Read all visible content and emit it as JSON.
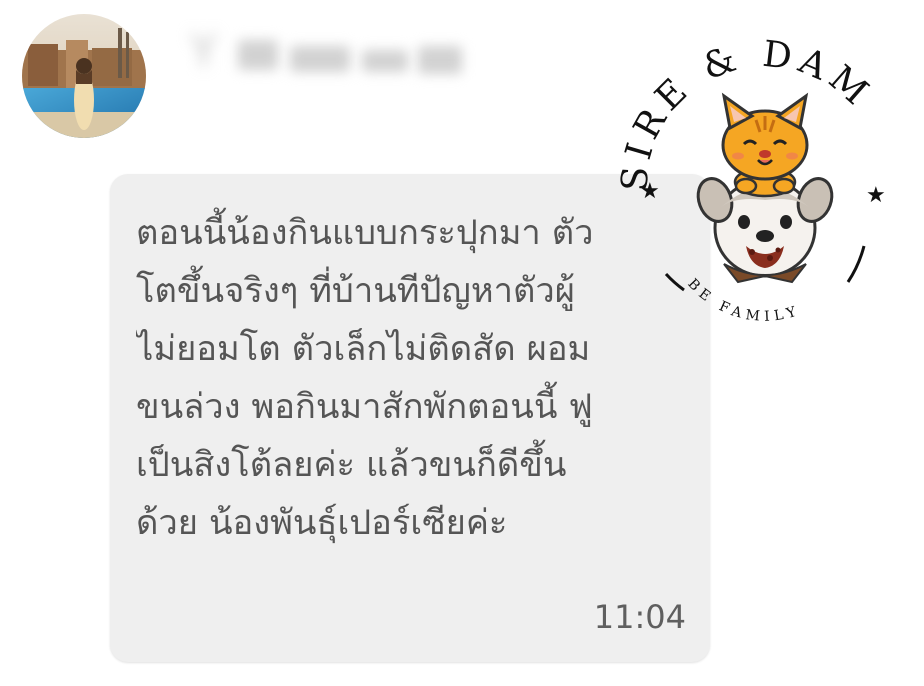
{
  "conversation": {
    "sender_name": "Y",
    "message_lines": [
      "ตอนนี้น้องกินแบบกระปุกมา ตัว",
      "โตขึ้นจริงๆ ที่บ้านทีปัญหาตัวผู้",
      "ไม่ยอมโต ตัวเล็กไม่ติดสัด ผอม",
      "ขนล่วง พอกินมาสักพักตอนนี้ ฟู",
      "เป็นสิงโต้ลยค่ะ แล้วขนก็ดีขึ้น",
      "ด้วย น้องพันธุ์เปอร์เซียค่ะ"
    ],
    "timestamp": "11:04"
  },
  "watermark": {
    "brand_top": "SIRE & DAM",
    "brand_bottom": "BE FAMILY",
    "colors": {
      "ink": "#111111",
      "cat": "#f5a623",
      "dog": "#cfc7bd"
    }
  },
  "icons": {
    "avatar": "user-avatar-photo",
    "logo": "cat-on-dog-logo"
  }
}
